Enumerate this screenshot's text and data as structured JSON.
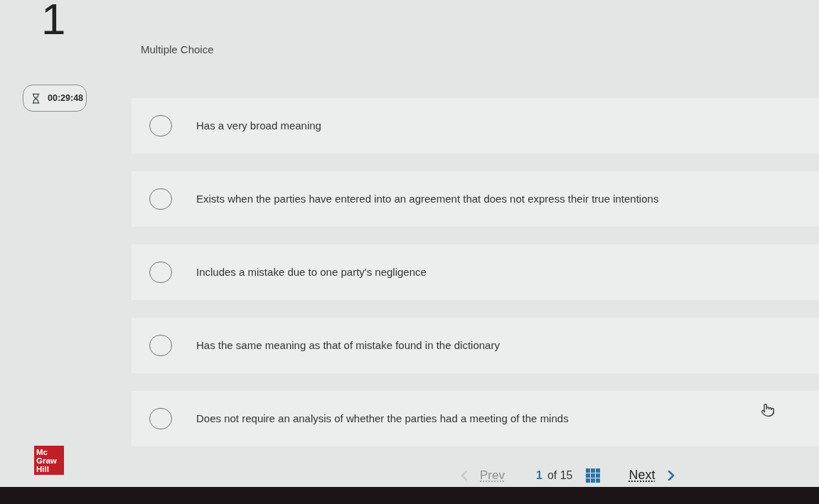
{
  "question": {
    "number": "1",
    "type_label": "Multiple Choice"
  },
  "timer": {
    "time": "00:29:48"
  },
  "options": [
    {
      "text": "Has a very broad meaning",
      "selected": false
    },
    {
      "text": "Exists when the parties have entered into an agreement that does not express their true intentions",
      "selected": false
    },
    {
      "text": "Includes a mistake due to one party's negligence",
      "selected": false
    },
    {
      "text": "Has the same meaning as that of mistake found in the dictionary",
      "selected": false
    },
    {
      "text": "Does not require an analysis of whether the parties had a meeting of the minds",
      "selected": false
    }
  ],
  "logo": {
    "lines": [
      "Mc",
      "Graw",
      "Hill"
    ]
  },
  "navigation": {
    "prev": {
      "label": "Prev",
      "disabled": true
    },
    "current": "1",
    "total": "of 15",
    "next": {
      "label": "Next",
      "disabled": false
    }
  }
}
